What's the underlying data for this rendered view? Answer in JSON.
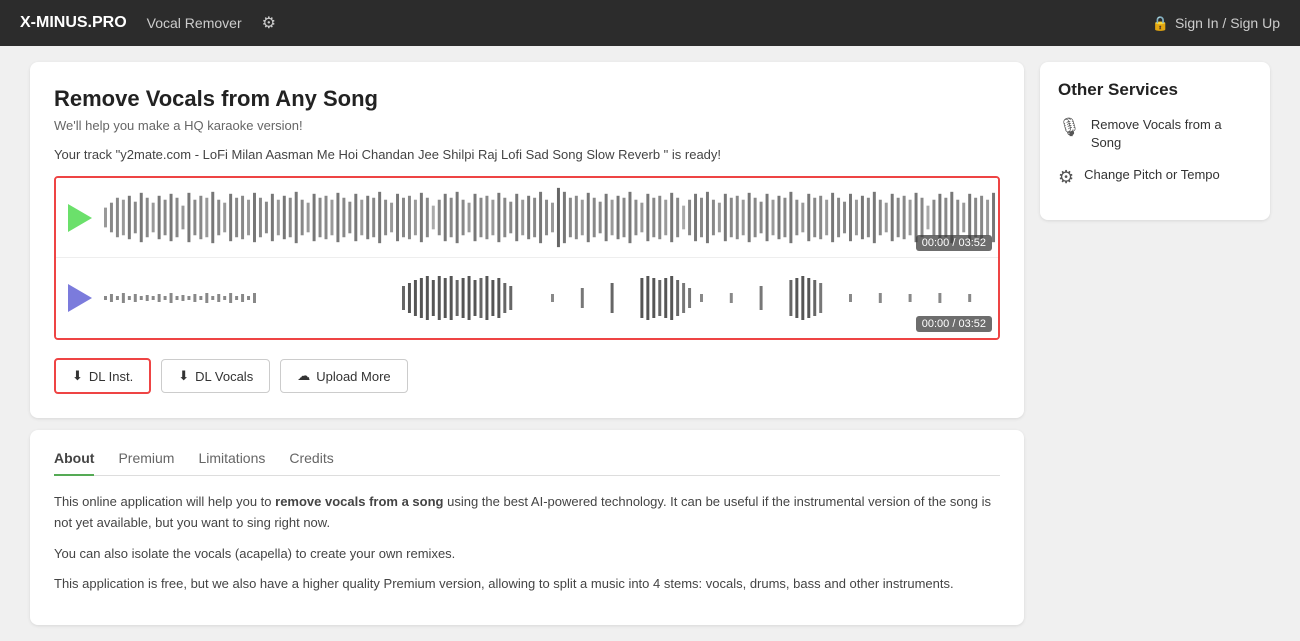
{
  "header": {
    "logo": "X-MINUS.PRO",
    "nav_label": "Vocal Remover",
    "sign_in_label": "Sign In / Sign Up"
  },
  "main": {
    "card": {
      "title": "Remove Vocals from Any Song",
      "subtitle": "We'll help you make a HQ karaoke version!",
      "track_ready_msg": "Your track \"y2mate.com - LoFi Milan Aasman Me Hoi Chandan Jee Shilpi Raj Lofi Sad Song Slow Reverb \" is ready!",
      "waveform_top_time": "00:00 / 03:52",
      "waveform_bottom_time": "00:00 / 03:52",
      "btn_dl_inst": "DL Inst.",
      "btn_dl_vocals": "DL Vocals",
      "btn_upload_more": "Upload More"
    },
    "about": {
      "tabs": [
        "About",
        "Premium",
        "Limitations",
        "Credits"
      ],
      "active_tab": "About",
      "paragraphs": [
        "This online application will help you to remove vocals from a song using the best AI-powered technology. It can be useful if the instrumental version of the song is not yet available, but you want to sing right now.",
        "You can also isolate the vocals (acapella) to create your own remixes.",
        "This application is free, but we also have a higher quality Premium version, allowing to split a music into 4 stems: vocals, drums, bass and other instruments."
      ],
      "bold_phrase": "remove vocals from a song"
    }
  },
  "sidebar": {
    "title": "Other Services",
    "items": [
      {
        "icon": "mic-off",
        "label": "Remove Vocals from a Song"
      },
      {
        "icon": "tune",
        "label": "Change Pitch or Tempo"
      }
    ]
  }
}
